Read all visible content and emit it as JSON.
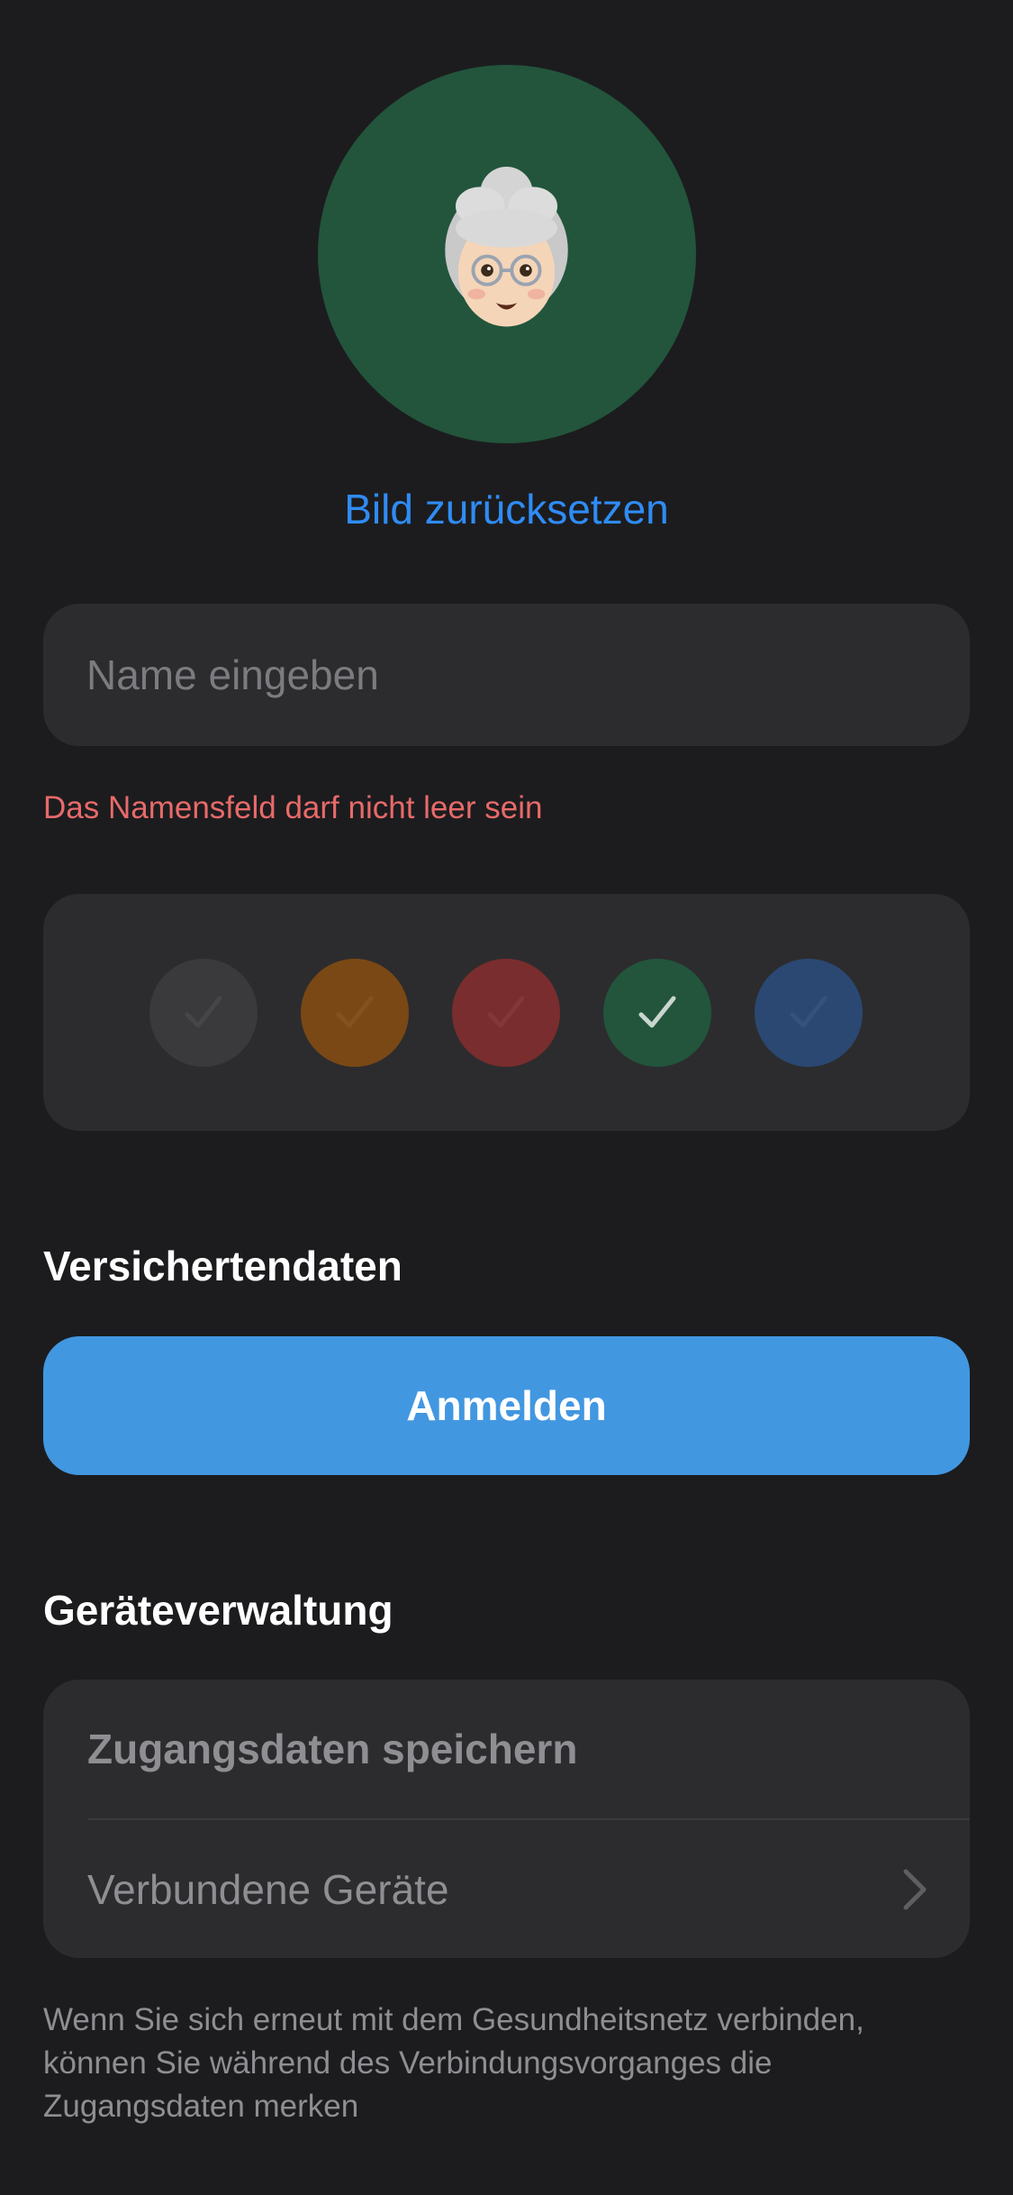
{
  "profile": {
    "avatar_icon": "memoji-grandmother-icon",
    "avatar_background": "#22553c",
    "reset_label": "Bild zurücksetzen"
  },
  "name_input": {
    "placeholder": "Name eingeben",
    "value": "",
    "error": "Das Namensfeld darf nicht leer sein"
  },
  "color_picker": {
    "colors": [
      {
        "name": "gray",
        "color": "#3a3a3c",
        "selected": false
      },
      {
        "name": "orange",
        "color": "#7a4815",
        "selected": false
      },
      {
        "name": "red",
        "color": "#7a2d2e",
        "selected": false
      },
      {
        "name": "green",
        "color": "#22553c",
        "selected": true
      },
      {
        "name": "blue",
        "color": "#2a4872",
        "selected": false
      }
    ],
    "check_icon": "checkmark-icon"
  },
  "insurance": {
    "title": "Versichertendaten",
    "login_label": "Anmelden"
  },
  "devices": {
    "title": "Geräteverwaltung",
    "save_credentials_label": "Zugangsdaten speichern",
    "connected_devices_label": "Verbundene Geräte",
    "footer": "Wenn Sie sich erneut mit dem Gesundheitsnetz verbinden, können Sie während des Verbindungsvorganges die Zugangsdaten merken"
  },
  "accent_colors": {
    "link": "#2f8cf5",
    "button": "#4297e1",
    "error": "#e86a6a"
  }
}
